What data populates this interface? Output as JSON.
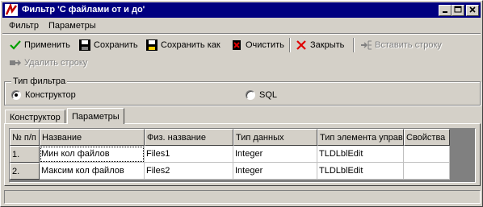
{
  "window": {
    "title": "Фильтр 'С файлами от и до'"
  },
  "menu": {
    "items": [
      "Фильтр",
      "Параметры"
    ]
  },
  "toolbar": {
    "apply": "Применить",
    "save": "Сохранить",
    "save_as": "Сохранить как",
    "clear": "Очистить",
    "close": "Закрыть",
    "insert_row": "Вставить строку",
    "delete_row": "Удалить строку"
  },
  "filter_type": {
    "legend": "Тип фильтра",
    "options": [
      "Конструктор",
      "SQL"
    ],
    "selected": "Конструктор"
  },
  "tabs": {
    "items": [
      "Конструктор",
      "Параметры"
    ],
    "active": "Параметры"
  },
  "grid": {
    "headers": [
      "№ п/п",
      "Название",
      "Физ. название",
      "Тип данных",
      "Тип элемента управ.",
      "Свойства"
    ],
    "rows": [
      [
        "1.",
        "Мин кол  файлов",
        "Files1",
        "Integer",
        "TLDLblEdit",
        ""
      ],
      [
        "2.",
        "Максим  кол файлов",
        "Files2",
        "Integer",
        "TLDLblEdit",
        ""
      ]
    ]
  },
  "colors": {
    "titlebar": "#000080",
    "face": "#d4d0c8"
  }
}
